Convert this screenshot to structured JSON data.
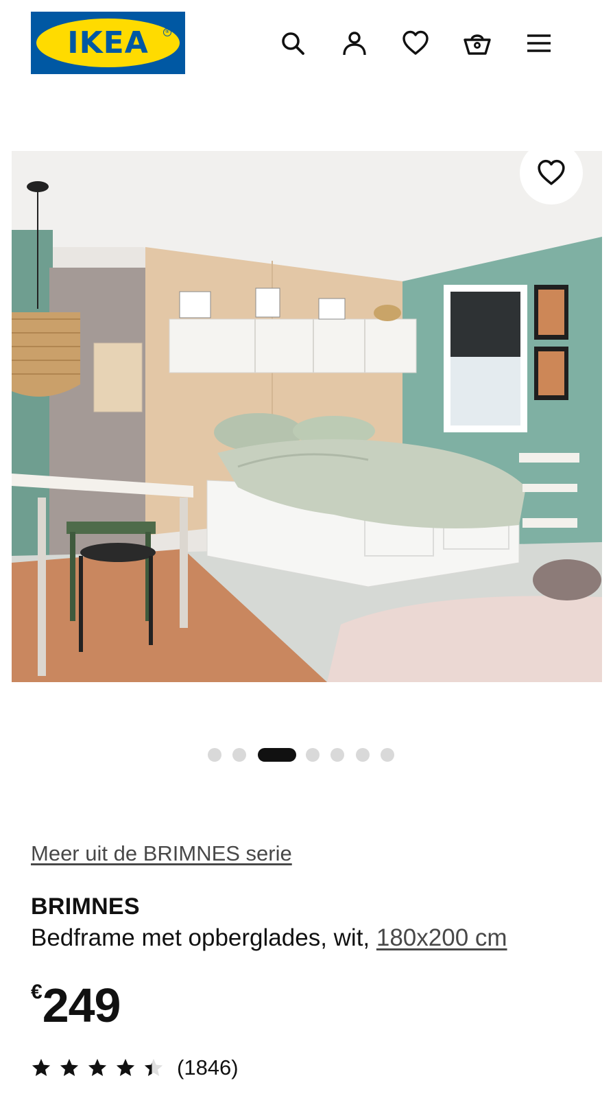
{
  "header": {
    "logo_text": "IKEA",
    "icons": [
      "search-icon",
      "account-icon",
      "heart-icon",
      "basket-icon",
      "menu-icon"
    ]
  },
  "gallery": {
    "slide_count": 7,
    "active_index": 2
  },
  "product": {
    "series_link": "Meer uit de BRIMNES serie",
    "name": "BRIMNES",
    "description": "Bedframe met opberglades, wit, ",
    "size_link": "180x200 cm",
    "currency": "€",
    "price": "249",
    "rating_value": 4.4,
    "rating_max": 5,
    "rating_count": "(1846)"
  },
  "colors": {
    "ikea_blue": "#0058a3",
    "ikea_yellow": "#ffdb00",
    "text": "#111111",
    "muted_text": "#484848",
    "dot_inactive": "#d9d9d9",
    "dot_active": "#111111"
  }
}
